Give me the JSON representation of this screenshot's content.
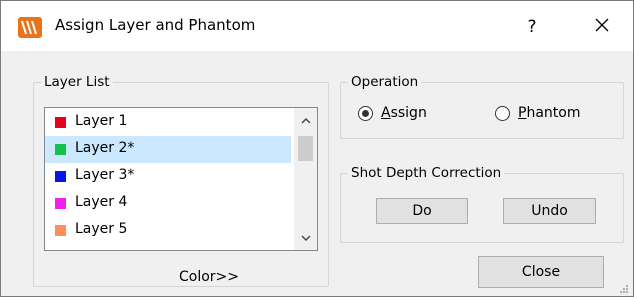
{
  "window": {
    "title": "Assign Layer and Phantom",
    "help_label": "?",
    "icons": {
      "app": "app-logo-icon",
      "close": "close-icon"
    }
  },
  "layer_list": {
    "group_label": "Layer List",
    "items": [
      {
        "label": "Layer 1",
        "color": "#e6001e",
        "selected": false
      },
      {
        "label": "Layer 2*",
        "color": "#12c24a",
        "selected": true
      },
      {
        "label": "Layer 3*",
        "color": "#0a14e6",
        "selected": false
      },
      {
        "label": "Layer 4",
        "color": "#f01ef0",
        "selected": false
      },
      {
        "label": "Layer 5",
        "color": "#ff8c5a",
        "selected": false
      }
    ],
    "color_button_label": "Color>>"
  },
  "operation": {
    "group_label": "Operation",
    "options": [
      {
        "label": "Assign",
        "checked": true
      },
      {
        "label": "Phantom",
        "checked": false
      }
    ]
  },
  "shot_depth": {
    "group_label": "Shot Depth Correction",
    "do_label": "Do",
    "undo_label": "Undo"
  },
  "footer": {
    "close_label": "Close"
  },
  "colors": {
    "selection": "#cce8ff",
    "dialog_bg": "#f0f0f0",
    "button_bg": "#e1e1e1"
  }
}
